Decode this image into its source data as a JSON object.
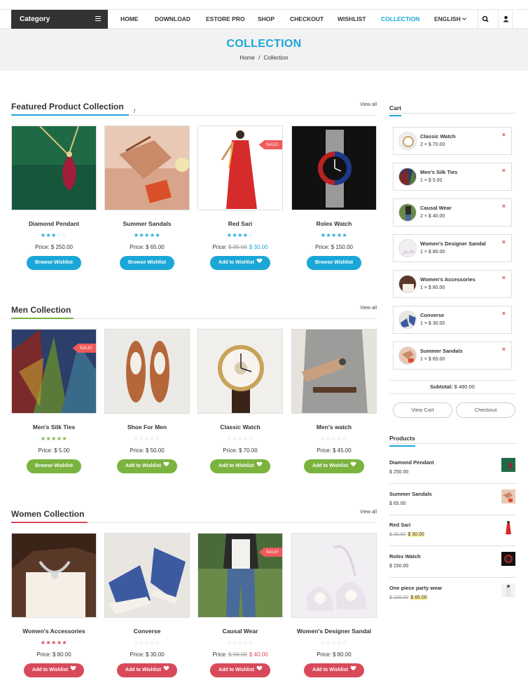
{
  "header": {
    "category_label": "Category",
    "nav": [
      "HOME",
      "DOWNLOAD",
      "ESTORE PRO",
      "SHOP",
      "CHECKOUT",
      "WISHLIST",
      "COLLECTION",
      "ENGLISH"
    ],
    "active_nav": "COLLECTION"
  },
  "banner": {
    "title": "COLLECTION",
    "crumb_home": "Home",
    "crumb_sep": "/",
    "crumb_current": "Collection"
  },
  "sections": [
    {
      "title": "Featured Product Collection",
      "title_mark": "/",
      "view_all": "View all",
      "accent": "#1aa7d7",
      "products": [
        {
          "name": "Diamond Pendant",
          "rating": 3,
          "price_label": "Price:",
          "price": "$ 250.00",
          "button": "Browse Wishlist",
          "sale": false
        },
        {
          "name": "Summer Sandals",
          "rating": 5,
          "price_label": "Price:",
          "price": "$ 65.00",
          "button": "Browse Wishlist",
          "sale": false
        },
        {
          "name": "Red Sari",
          "rating": 4,
          "price_label": "Price:",
          "old_price": "$ 35.00",
          "price": "$ 30.00",
          "button": "Add to Wishlist",
          "sale": true,
          "sale_label": "SALE!"
        },
        {
          "name": "Rolex Watch",
          "rating": 5,
          "price_label": "Price:",
          "price": "$ 150.00",
          "button": "Browse Wishlist",
          "sale": false
        }
      ]
    },
    {
      "title": "Men Collection",
      "view_all": "View all",
      "accent": "#7ab33e",
      "products": [
        {
          "name": "Men's Silk Ties",
          "rating": 5,
          "price_label": "Price:",
          "price": "$ 5.00",
          "button": "Browse Wishlist",
          "sale": true,
          "sale_label": "SALE!"
        },
        {
          "name": "Shoe For Men",
          "rating": 0,
          "price_label": "Price:",
          "price": "$ 50.00",
          "button": "Add to Wishlist",
          "sale": false
        },
        {
          "name": "Classic Watch",
          "rating": 0,
          "price_label": "Price:",
          "price": "$ 70.00",
          "button": "Add to Wishlist",
          "sale": false
        },
        {
          "name": "Men's watch",
          "rating": 0,
          "price_label": "Price:",
          "price": "$ 45.00",
          "button": "Add to Wishlist",
          "sale": false
        }
      ]
    },
    {
      "title": "Women Collection",
      "view_all": "View all",
      "accent": "#d84a5a",
      "products": [
        {
          "name": "Women's Accessories",
          "rating": 5,
          "price_label": "Price:",
          "price": "$ 80.00",
          "button": "Add to Wishlist",
          "sale": false
        },
        {
          "name": "Converse",
          "rating": 0,
          "price_label": "Price:",
          "price": "$ 30.00",
          "button": "Add to Wishlist",
          "sale": false
        },
        {
          "name": "Causal Wear",
          "rating": 0,
          "price_label": "Price:",
          "old_price": "$ 50.00",
          "price": "$ 40.00",
          "button": "Add to Wishlist",
          "sale": true,
          "sale_label": "SALE!"
        },
        {
          "name": "Women's Designer Sandal",
          "rating": 0,
          "price_label": "Price:",
          "price": "$ 80.00",
          "button": "Add to Wishlist",
          "sale": false
        }
      ]
    }
  ],
  "cart": {
    "title": "Cart",
    "items": [
      {
        "name": "Classic Watch",
        "qty": "2 × $ 70.00",
        "remove": "×"
      },
      {
        "name": "Men's Silk Ties",
        "qty": "1 × $ 5.00",
        "remove": "×"
      },
      {
        "name": "Causal Wear",
        "qty": "2 × $ 40.00",
        "remove": "×"
      },
      {
        "name": "Women's Designer Sandal",
        "qty": "1 × $ 80.00",
        "remove": "×"
      },
      {
        "name": "Women's Accessories",
        "qty": "1 × $ 80.00",
        "remove": "×"
      },
      {
        "name": "Converse",
        "qty": "1 × $ 30.00",
        "remove": "×"
      },
      {
        "name": "Summer Sandals",
        "qty": "1 × $ 65.00",
        "remove": "×"
      }
    ],
    "subtotal_label": "Subtotal:",
    "subtotal": "$ 480.00",
    "view_cart": "View Cart",
    "checkout": "Checkout"
  },
  "products_widget": {
    "title": "Products",
    "items": [
      {
        "name": "Diamond Pendant",
        "price": "$ 250.00"
      },
      {
        "name": "Summer Sandals",
        "price": "$ 65.00"
      },
      {
        "name": "Red Sari",
        "old_price": "$ 35.00",
        "price": "$ 30.00"
      },
      {
        "name": "Rolex Watch",
        "price": "$ 150.00"
      },
      {
        "name": "One piece party wear",
        "old_price": "$ 100.00",
        "price": "$ 85.00"
      }
    ]
  },
  "colors": {
    "brand": "#1aa7d7",
    "men": "#7ab33e",
    "women": "#d84a5a",
    "star_empty": "#cccccc"
  }
}
